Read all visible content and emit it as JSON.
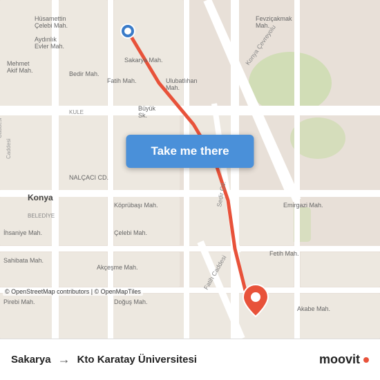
{
  "map": {
    "attribution": "© OpenStreetMap contributors | © OpenMapTiles",
    "center_lat": 37.88,
    "center_lng": 32.49
  },
  "button": {
    "label": "Take me there"
  },
  "route": {
    "from": "Sakarya",
    "arrow": "→",
    "to": "Kto Karatay Üniversitesi"
  },
  "branding": {
    "logo_text": "moovit",
    "dot_color": "#e8523a"
  },
  "colors": {
    "map_bg": "#e8e0d8",
    "road_major": "#ffffff",
    "road_minor": "#f5f0ea",
    "park": "#c8dba8",
    "button_bg": "#4a90d9",
    "pin_red": "#e8523a",
    "pin_blue": "#3a7bc8",
    "route_line": "#e8523a"
  }
}
